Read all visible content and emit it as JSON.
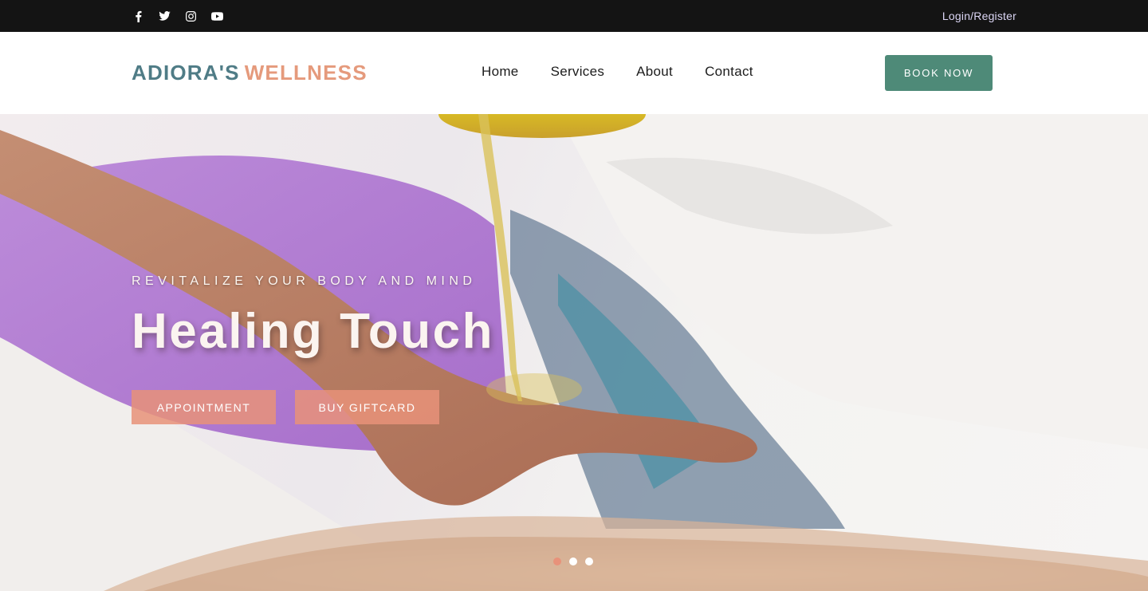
{
  "topbar": {
    "social": [
      {
        "icon": "facebook-icon"
      },
      {
        "icon": "twitter-icon"
      },
      {
        "icon": "instagram-icon"
      },
      {
        "icon": "youtube-icon"
      }
    ],
    "login_label": "Login/Register"
  },
  "header": {
    "logo_part1": "ADIORA'S",
    "logo_part2": "WELLNESS",
    "nav": [
      "Home",
      "Services",
      "About",
      "Contact"
    ],
    "book_label": "BOOK NOW"
  },
  "hero": {
    "kicker": "REVITALIZE YOUR BODY AND MIND",
    "title": "Healing Touch",
    "appointment_label": "APPOINTMENT",
    "giftcard_label": "BUY GIFTCARD",
    "slides": 3,
    "active_slide": 1
  },
  "colors": {
    "topbar_bg": "#141414",
    "logo_teal": "#4f7c86",
    "logo_peach": "#e59a7c",
    "book_button": "#4e8a78",
    "hero_button": "#e8927a",
    "dot_active": "#e8927a"
  }
}
